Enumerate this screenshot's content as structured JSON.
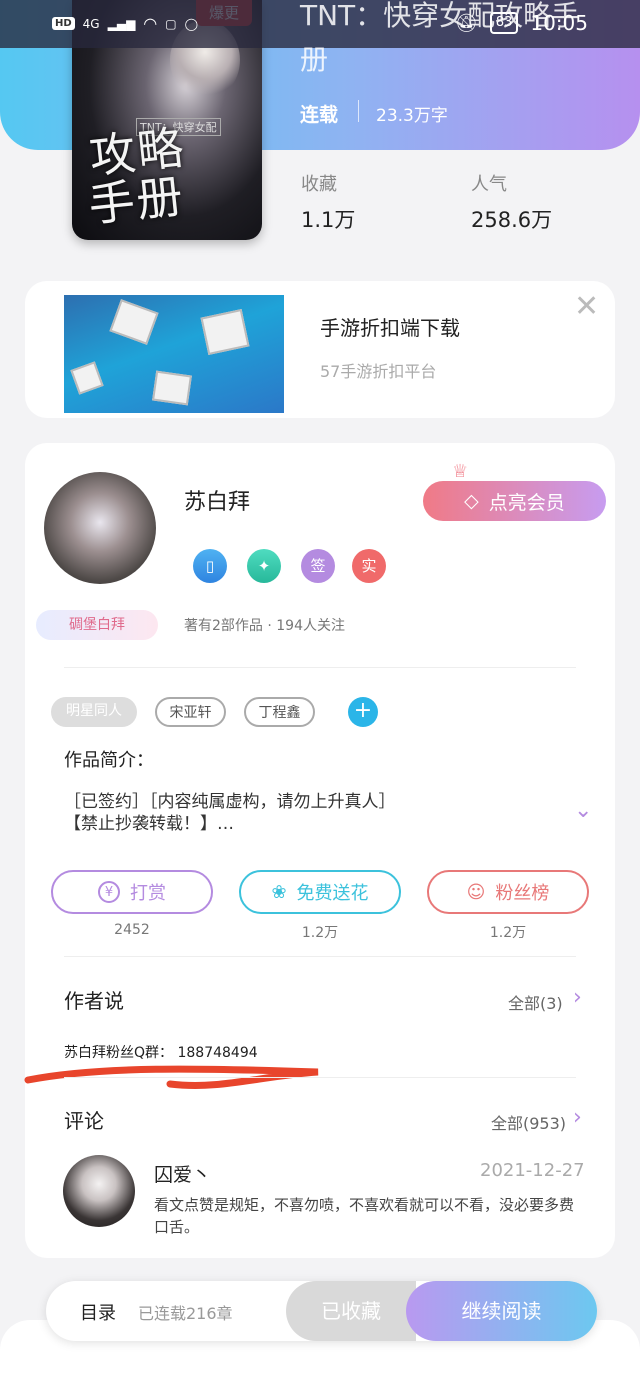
{
  "status_bar": {
    "left_badges": [
      "HD",
      "4G"
    ],
    "battery": "83",
    "time": "10:05"
  },
  "book": {
    "cover_tag": "爆更",
    "cover_subtitle": "TNT：快穿女配",
    "cover_title_line1": "攻略",
    "cover_title_line2": "手册",
    "title": "TNT：快穿女配攻略手册",
    "status": "连载",
    "word_count": "23.3万字",
    "stats": [
      {
        "label": "收藏",
        "value": "1.1万"
      },
      {
        "label": "人气",
        "value": "258.6万"
      }
    ]
  },
  "ad": {
    "title": "手游折扣端下载",
    "subtitle": "57手游折扣平台",
    "close_symbol": "✕"
  },
  "author": {
    "name": "苏白拜",
    "tag": "碉堡白拜",
    "vip_button": "点亮会员",
    "badges": [
      "签",
      "实"
    ],
    "meta": "著有2部作品 · 194人关注"
  },
  "tags": [
    "明星同人",
    "宋亚轩",
    "丁程鑫"
  ],
  "intro": {
    "label": "作品简介：",
    "line1": "［已签约］［内容纯属虚构，请勿上升真人］",
    "line2": "【禁止抄袭转载！】…"
  },
  "actions": [
    {
      "label": "打赏",
      "count": "2452",
      "color": "#b48be0"
    },
    {
      "label": "免费送花",
      "count": "1.2万",
      "color": "#3cc2dc"
    },
    {
      "label": "粉丝榜",
      "count": "1.2万",
      "color": "#e87878"
    }
  ],
  "author_says": {
    "title": "作者说",
    "all_link": "全部(3)",
    "text": "苏白拜粉丝Q群：  188748494"
  },
  "comments": {
    "title": "评论",
    "all_link": "全部(953)",
    "items": [
      {
        "name": "囚爱丶",
        "date": "2021-12-27",
        "text": "看文点赞是规矩，不喜勿喷，不喜欢看就可以不看，没必要多费口舌。"
      }
    ]
  },
  "bottom_bar": {
    "toc": "目录",
    "chapters": "已连载216章",
    "favorited": "已收藏",
    "continue": "继续阅读"
  }
}
